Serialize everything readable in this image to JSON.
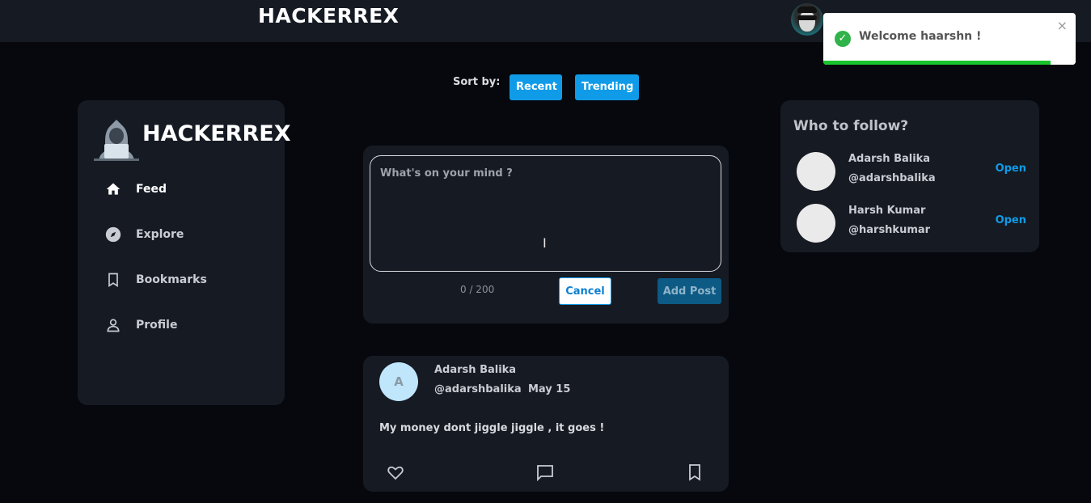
{
  "app": {
    "brand": "HACKERREX",
    "sidebar_brand": "HACKERREX"
  },
  "toast": {
    "message": "Welcome haarshn !",
    "close": "×",
    "progress": 0.9
  },
  "sort": {
    "label": "Sort by:",
    "options": [
      "Recent",
      "Trending"
    ]
  },
  "sidebar": {
    "items": [
      {
        "label": "Feed",
        "icon": "home-icon"
      },
      {
        "label": "Explore",
        "icon": "compass-icon"
      },
      {
        "label": "Bookmarks",
        "icon": "bookmark-icon"
      },
      {
        "label": "Profile",
        "icon": "person-icon"
      }
    ]
  },
  "composer": {
    "placeholder": "What's on your mind ?",
    "value": "",
    "char_count": "0 / 200",
    "cancel_label": "Cancel",
    "add_label": "Add Post"
  },
  "post": {
    "avatar_initial": "A",
    "author": "Adarsh Balika",
    "handle": "@adarshbalika",
    "date": "May 15",
    "text": "My money dont jiggle jiggle , it goes !"
  },
  "follow": {
    "title": "Who to follow?",
    "users": [
      {
        "name": "Adarsh Balika",
        "handle": "@adarshbalika",
        "action": "Open"
      },
      {
        "name": "Harsh Kumar",
        "handle": "@harshkumar",
        "action": "Open"
      }
    ]
  },
  "colors": {
    "accent": "#0f9be8",
    "success": "#19c52d",
    "card": "#161a23",
    "background": "#06080d"
  }
}
